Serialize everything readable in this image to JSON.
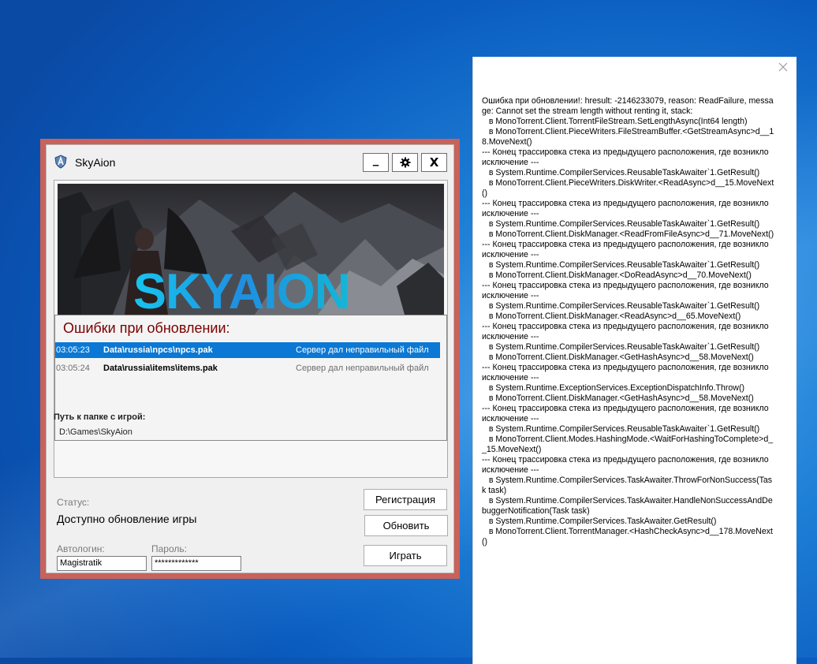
{
  "launcher": {
    "title": "SkyAion",
    "window_buttons": {
      "minimize": "_",
      "settings_icon": "gear-icon",
      "close": "X"
    },
    "banner_title": "SKYAION",
    "errors_title": "Ошибки при обновлении:",
    "errors": [
      {
        "time": "03:05:23",
        "file": "Data\\russia\\npcs\\npcs.pak",
        "message": "Сервер дал неправильный файл",
        "selected": true
      },
      {
        "time": "03:05:24",
        "file": "Data\\russia\\items\\items.pak",
        "message": "Сервер дал неправильный файл",
        "selected": false
      }
    ],
    "path_label": "Путь к папке с игрой:",
    "path_value": "D:\\Games\\SkyAion",
    "status_label": "Статус:",
    "status_value": "Доступно обновление игры",
    "register_button": "Регистрация",
    "update_button": "Обновить",
    "play_button": "Играть",
    "autologin_label": "Автологин:",
    "autologin_value": "Magistratik",
    "password_label": "Пароль:",
    "password_value": "*************",
    "colors": {
      "frame": "#c8625a",
      "selection": "#0a78d4",
      "errors_title": "#7a0000",
      "banner_text": "#16c5f0"
    }
  },
  "log_window": {
    "close_icon": "close-icon",
    "text": "Ошибка при обновлении!: hresult: -2146233079, reason: ReadFailure, message: Cannot set the stream length without renting it, stack:\n   в MonoTorrent.Client.TorrentFileStream.SetLengthAsync(Int64 length)\n   в MonoTorrent.Client.PieceWriters.FileStreamBuffer.<GetStreamAsync>d__18.MoveNext()\n--- Конец трассировка стека из предыдущего расположения, где возникло исключение ---\n   в System.Runtime.CompilerServices.ReusableTaskAwaiter`1.GetResult()\n   в MonoTorrent.Client.PieceWriters.DiskWriter.<ReadAsync>d__15.MoveNext()\n--- Конец трассировка стека из предыдущего расположения, где возникло исключение ---\n   в System.Runtime.CompilerServices.ReusableTaskAwaiter`1.GetResult()\n   в MonoTorrent.Client.DiskManager.<ReadFromFileAsync>d__71.MoveNext()\n--- Конец трассировка стека из предыдущего расположения, где возникло исключение ---\n   в System.Runtime.CompilerServices.ReusableTaskAwaiter`1.GetResult()\n   в MonoTorrent.Client.DiskManager.<DoReadAsync>d__70.MoveNext()\n--- Конец трассировка стека из предыдущего расположения, где возникло исключение ---\n   в System.Runtime.CompilerServices.ReusableTaskAwaiter`1.GetResult()\n   в MonoTorrent.Client.DiskManager.<ReadAsync>d__65.MoveNext()\n--- Конец трассировка стека из предыдущего расположения, где возникло исключение ---\n   в System.Runtime.CompilerServices.ReusableTaskAwaiter`1.GetResult()\n   в MonoTorrent.Client.DiskManager.<GetHashAsync>d__58.MoveNext()\n--- Конец трассировка стека из предыдущего расположения, где возникло исключение ---\n   в System.Runtime.ExceptionServices.ExceptionDispatchInfo.Throw()\n   в MonoTorrent.Client.DiskManager.<GetHashAsync>d__58.MoveNext()\n--- Конец трассировка стека из предыдущего расположения, где возникло исключение ---\n   в System.Runtime.CompilerServices.ReusableTaskAwaiter`1.GetResult()\n   в MonoTorrent.Client.Modes.HashingMode.<WaitForHashingToComplete>d__15.MoveNext()\n--- Конец трассировка стека из предыдущего расположения, где возникло исключение ---\n   в System.Runtime.CompilerServices.TaskAwaiter.ThrowForNonSuccess(Task task)\n   в System.Runtime.CompilerServices.TaskAwaiter.HandleNonSuccessAndDebuggerNotification(Task task)\n   в System.Runtime.CompilerServices.TaskAwaiter.GetResult()\n   в MonoTorrent.Client.TorrentManager.<HashCheckAsync>d__178.MoveNext()"
  }
}
